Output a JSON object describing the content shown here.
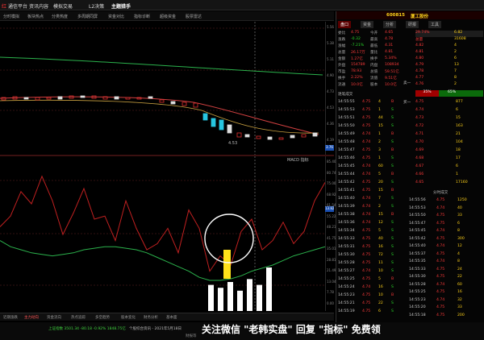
{
  "app": {
    "logo": "红",
    "nav": [
      "通信平台",
      "资讯内容",
      "模拟交易",
      "L2决策",
      "主题猎手"
    ]
  },
  "tabs": [
    "分时模拟",
    "板块热点",
    "分类热度",
    "多周期同屏",
    "资金对比",
    "指标诊断",
    "超级资金",
    "股票雷达"
  ],
  "chart": {
    "price_axis": [
      "5.56",
      "5.38",
      "5.11",
      "4.90",
      "4.73",
      "4.53",
      "4.36",
      "4.19"
    ],
    "flag_label": "4.53",
    "price_tag": "3.76",
    "ind_axis": [
      "85.40",
      "80.74",
      "75.00",
      "68.92",
      "61.54",
      "55.22",
      "48.21",
      "41.75",
      "35.01",
      "28.81",
      "21.49",
      "13.04",
      "7.78",
      "0.00"
    ],
    "ind_title": "MACD 指标",
    "ind_value": "13.82",
    "ind_vals": [
      55,
      62,
      78,
      70,
      88,
      72,
      50,
      64,
      80,
      60,
      62,
      46,
      72,
      54,
      40,
      44,
      54,
      38,
      66,
      54,
      26,
      36,
      30,
      52,
      60,
      40,
      46,
      58,
      44,
      52,
      72,
      84
    ],
    "ind_vals2": [
      46,
      42,
      40,
      38,
      37,
      36,
      37,
      38,
      40,
      41,
      42,
      42,
      41,
      40,
      38,
      35,
      32,
      29,
      26,
      22,
      20,
      20,
      21,
      23,
      26,
      28,
      30,
      33,
      36,
      38,
      40,
      42
    ],
    "hist": [
      18,
      16,
      20,
      14,
      22,
      18,
      30
    ]
  },
  "bottom_tabs": [
    "近期涨跌",
    "主力动向",
    "资金流向",
    "热点追踪",
    "多空趋势",
    "股本变化",
    "财务分析",
    "基本面"
  ],
  "status": {
    "index": "上证指数 3501.34 -80.18 -0.92% 1848.75亿",
    "news": "个股综合资讯 - 2021年5月18日",
    "extra": "财报等"
  },
  "right": {
    "code": "600815",
    "name": "厦工股份",
    "tabs": [
      "盘口",
      "资金",
      "分析",
      "研报",
      "工具"
    ],
    "rows": [
      [
        "委比",
        "4.75",
        "今开",
        "4.65"
      ],
      [
        "涨跌",
        "-0.32",
        "最高",
        "4.78"
      ],
      [
        "涨幅",
        "-7.21%",
        "最低",
        "4.31"
      ],
      [
        "总量",
        "26.17万",
        "量比",
        "4.81"
      ],
      [
        "金额",
        "1.27亿",
        "换手",
        "5.34%"
      ],
      [
        "外盘",
        "154789",
        "内盘",
        "108934"
      ],
      [
        "市盈",
        "78.93",
        "总值",
        "59.51亿"
      ],
      [
        "换手",
        "2.22%",
        "流值",
        "9.51亿"
      ],
      [
        "流通",
        "10.0亿",
        "股本",
        "10.0亿"
      ]
    ],
    "side_label": [
      "卖一",
      "买一"
    ],
    "sells": [
      [
        "29.74%",
        "6.82"
      ],
      [
        "总量",
        "31608"
      ],
      [
        "4.82",
        "4"
      ],
      [
        "4.81",
        "2"
      ],
      [
        "4.80",
        "6"
      ],
      [
        "4.79",
        "13"
      ],
      [
        "4.78",
        "7"
      ],
      [
        "4.77",
        "8"
      ],
      [
        "4.76",
        "2"
      ]
    ],
    "bar_left": "35%",
    "bar_right": "65%",
    "buys": [
      [
        "4.75",
        "877"
      ],
      [
        "4.74",
        "6"
      ],
      [
        "4.73",
        "15"
      ],
      [
        "4.72",
        "163"
      ],
      [
        "4.71",
        "21"
      ],
      [
        "4.70",
        "104"
      ],
      [
        "4.69",
        "18"
      ],
      [
        "4.68",
        "17"
      ],
      [
        "4.67",
        "6"
      ],
      [
        "4.66",
        "1"
      ],
      [
        "4.65",
        "17160"
      ]
    ],
    "ticks_header": "逐笔成交",
    "ticks": [
      [
        "14:55:55",
        "4.75",
        "4",
        "B"
      ],
      [
        "14:55:53",
        "4.75",
        "1",
        "S"
      ],
      [
        "14:55:51",
        "4.75",
        "44",
        "S"
      ],
      [
        "14:55:50",
        "4.75",
        "15",
        "S"
      ],
      [
        "14:55:49",
        "4.74",
        "1",
        "B"
      ],
      [
        "14:55:48",
        "4.74",
        "2",
        "S"
      ],
      [
        "14:55:47",
        "4.75",
        "3",
        "B"
      ],
      [
        "14:55:46",
        "4.75",
        "1",
        "S"
      ],
      [
        "14:55:45",
        "4.74",
        "60",
        "S"
      ],
      [
        "14:55:44",
        "4.74",
        "5",
        "B"
      ],
      [
        "14:55:42",
        "4.75",
        "20",
        "S"
      ],
      [
        "14:55:41",
        "4.75",
        "15",
        "B"
      ],
      [
        "14:55:40",
        "4.74",
        "7",
        "S"
      ],
      [
        "14:55:39",
        "4.74",
        "2",
        "S"
      ],
      [
        "14:55:38",
        "4.74",
        "15",
        "B"
      ],
      [
        "14:55:36",
        "4.74",
        "12",
        "S"
      ],
      [
        "14:55:34",
        "4.75",
        "5",
        "S"
      ],
      [
        "14:55:33",
        "4.75",
        "40",
        "S"
      ],
      [
        "14:55:31",
        "4.75",
        "16",
        "S"
      ],
      [
        "14:55:30",
        "4.75",
        "72",
        "S"
      ],
      [
        "14:55:28",
        "4.75",
        "11",
        "S"
      ],
      [
        "14:55:27",
        "4.74",
        "10",
        "S"
      ],
      [
        "14:55:25",
        "4.75",
        "5",
        "B"
      ],
      [
        "14:55:24",
        "4.74",
        "16",
        "S"
      ],
      [
        "14:55:23",
        "4.75",
        "10",
        "B"
      ],
      [
        "14:55:21",
        "4.75",
        "22",
        "S"
      ],
      [
        "14:55:19",
        "4.75",
        "6",
        "S"
      ]
    ],
    "ticks2_header": "分时成交",
    "ticks2": [
      [
        "14:55:56",
        "4.75",
        "1250"
      ],
      [
        "14:55:53",
        "4.74",
        "40"
      ],
      [
        "14:55:50",
        "4.75",
        "33"
      ],
      [
        "14:55:47",
        "4.75",
        "6"
      ],
      [
        "14:55:45",
        "4.74",
        "8"
      ],
      [
        "14:55:42",
        "4.75",
        "300"
      ],
      [
        "14:55:40",
        "4.74",
        "12"
      ],
      [
        "14:55:37",
        "4.75",
        "4"
      ],
      [
        "14:55:35",
        "4.74",
        "8"
      ],
      [
        "14:55:33",
        "4.75",
        "24"
      ],
      [
        "14:55:30",
        "4.75",
        "22"
      ],
      [
        "14:55:28",
        "4.74",
        "60"
      ],
      [
        "14:55:25",
        "4.75",
        "16"
      ],
      [
        "14:55:23",
        "4.74",
        "32"
      ],
      [
        "14:55:20",
        "4.75",
        "33"
      ],
      [
        "14:55:18",
        "4.75",
        "200"
      ]
    ]
  },
  "watermark": "关注微信 \"老韩实盘\" 回复 \"指标\" 免费领"
}
